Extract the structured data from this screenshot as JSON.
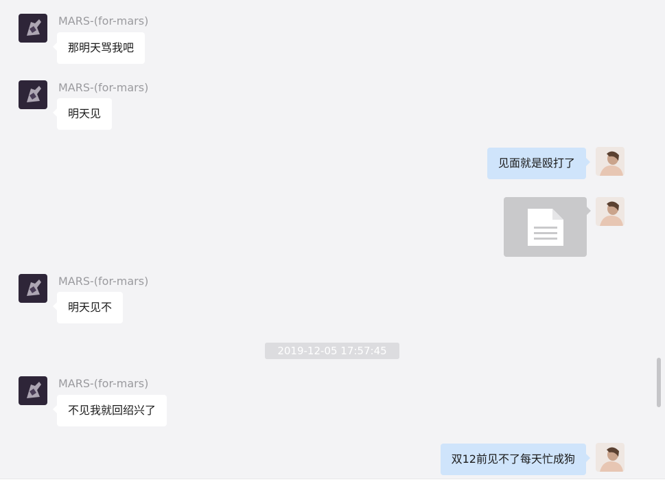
{
  "messages": [
    {
      "sender": "MARS-(for-mars)",
      "text": "那明天骂我吧",
      "direction": "incoming"
    },
    {
      "sender": "MARS-(for-mars)",
      "text": "明天见",
      "direction": "incoming"
    },
    {
      "text": "见面就是殴打了",
      "direction": "outgoing"
    },
    {
      "attachment": "document-icon",
      "direction": "outgoing"
    },
    {
      "sender": "MARS-(for-mars)",
      "text": "明天见不",
      "direction": "incoming"
    },
    {
      "timestamp": "2019-12-05 17:57:45"
    },
    {
      "sender": "MARS-(for-mars)",
      "text": "不见我就回绍兴了",
      "direction": "incoming"
    },
    {
      "text": "双12前见不了每天忙成狗",
      "direction": "outgoing"
    }
  ],
  "colors": {
    "background": "#f3f3f5",
    "incoming_bubble": "#ffffff",
    "outgoing_bubble": "#cfe4fb",
    "sender_name": "#9a9a9e",
    "timestamp_pill": "#dcdcdf",
    "file_card": "#c9c9cb"
  },
  "icons": {
    "incoming_avatar": "dark-avatar-icon",
    "outgoing_avatar": "photo-avatar-icon",
    "attachment": "document-icon"
  }
}
